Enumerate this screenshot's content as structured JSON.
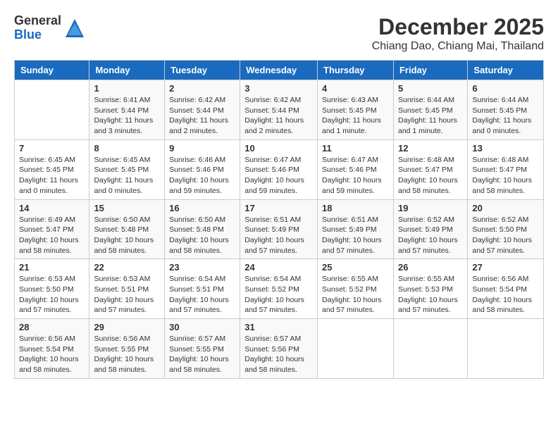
{
  "logo": {
    "general": "General",
    "blue": "Blue"
  },
  "title": "December 2025",
  "location": "Chiang Dao, Chiang Mai, Thailand",
  "days_header": [
    "Sunday",
    "Monday",
    "Tuesday",
    "Wednesday",
    "Thursday",
    "Friday",
    "Saturday"
  ],
  "weeks": [
    [
      {
        "day": "",
        "content": ""
      },
      {
        "day": "1",
        "content": "Sunrise: 6:41 AM\nSunset: 5:44 PM\nDaylight: 11 hours\nand 3 minutes."
      },
      {
        "day": "2",
        "content": "Sunrise: 6:42 AM\nSunset: 5:44 PM\nDaylight: 11 hours\nand 2 minutes."
      },
      {
        "day": "3",
        "content": "Sunrise: 6:42 AM\nSunset: 5:44 PM\nDaylight: 11 hours\nand 2 minutes."
      },
      {
        "day": "4",
        "content": "Sunrise: 6:43 AM\nSunset: 5:45 PM\nDaylight: 11 hours\nand 1 minute."
      },
      {
        "day": "5",
        "content": "Sunrise: 6:44 AM\nSunset: 5:45 PM\nDaylight: 11 hours\nand 1 minute."
      },
      {
        "day": "6",
        "content": "Sunrise: 6:44 AM\nSunset: 5:45 PM\nDaylight: 11 hours\nand 0 minutes."
      }
    ],
    [
      {
        "day": "7",
        "content": "Sunrise: 6:45 AM\nSunset: 5:45 PM\nDaylight: 11 hours\nand 0 minutes."
      },
      {
        "day": "8",
        "content": "Sunrise: 6:45 AM\nSunset: 5:45 PM\nDaylight: 11 hours\nand 0 minutes."
      },
      {
        "day": "9",
        "content": "Sunrise: 6:46 AM\nSunset: 5:46 PM\nDaylight: 10 hours\nand 59 minutes."
      },
      {
        "day": "10",
        "content": "Sunrise: 6:47 AM\nSunset: 5:46 PM\nDaylight: 10 hours\nand 59 minutes."
      },
      {
        "day": "11",
        "content": "Sunrise: 6:47 AM\nSunset: 5:46 PM\nDaylight: 10 hours\nand 59 minutes."
      },
      {
        "day": "12",
        "content": "Sunrise: 6:48 AM\nSunset: 5:47 PM\nDaylight: 10 hours\nand 58 minutes."
      },
      {
        "day": "13",
        "content": "Sunrise: 6:48 AM\nSunset: 5:47 PM\nDaylight: 10 hours\nand 58 minutes."
      }
    ],
    [
      {
        "day": "14",
        "content": "Sunrise: 6:49 AM\nSunset: 5:47 PM\nDaylight: 10 hours\nand 58 minutes."
      },
      {
        "day": "15",
        "content": "Sunrise: 6:50 AM\nSunset: 5:48 PM\nDaylight: 10 hours\nand 58 minutes."
      },
      {
        "day": "16",
        "content": "Sunrise: 6:50 AM\nSunset: 5:48 PM\nDaylight: 10 hours\nand 58 minutes."
      },
      {
        "day": "17",
        "content": "Sunrise: 6:51 AM\nSunset: 5:49 PM\nDaylight: 10 hours\nand 57 minutes."
      },
      {
        "day": "18",
        "content": "Sunrise: 6:51 AM\nSunset: 5:49 PM\nDaylight: 10 hours\nand 57 minutes."
      },
      {
        "day": "19",
        "content": "Sunrise: 6:52 AM\nSunset: 5:49 PM\nDaylight: 10 hours\nand 57 minutes."
      },
      {
        "day": "20",
        "content": "Sunrise: 6:52 AM\nSunset: 5:50 PM\nDaylight: 10 hours\nand 57 minutes."
      }
    ],
    [
      {
        "day": "21",
        "content": "Sunrise: 6:53 AM\nSunset: 5:50 PM\nDaylight: 10 hours\nand 57 minutes."
      },
      {
        "day": "22",
        "content": "Sunrise: 6:53 AM\nSunset: 5:51 PM\nDaylight: 10 hours\nand 57 minutes."
      },
      {
        "day": "23",
        "content": "Sunrise: 6:54 AM\nSunset: 5:51 PM\nDaylight: 10 hours\nand 57 minutes."
      },
      {
        "day": "24",
        "content": "Sunrise: 6:54 AM\nSunset: 5:52 PM\nDaylight: 10 hours\nand 57 minutes."
      },
      {
        "day": "25",
        "content": "Sunrise: 6:55 AM\nSunset: 5:52 PM\nDaylight: 10 hours\nand 57 minutes."
      },
      {
        "day": "26",
        "content": "Sunrise: 6:55 AM\nSunset: 5:53 PM\nDaylight: 10 hours\nand 57 minutes."
      },
      {
        "day": "27",
        "content": "Sunrise: 6:56 AM\nSunset: 5:54 PM\nDaylight: 10 hours\nand 58 minutes."
      }
    ],
    [
      {
        "day": "28",
        "content": "Sunrise: 6:56 AM\nSunset: 5:54 PM\nDaylight: 10 hours\nand 58 minutes."
      },
      {
        "day": "29",
        "content": "Sunrise: 6:56 AM\nSunset: 5:55 PM\nDaylight: 10 hours\nand 58 minutes."
      },
      {
        "day": "30",
        "content": "Sunrise: 6:57 AM\nSunset: 5:55 PM\nDaylight: 10 hours\nand 58 minutes."
      },
      {
        "day": "31",
        "content": "Sunrise: 6:57 AM\nSunset: 5:56 PM\nDaylight: 10 hours\nand 58 minutes."
      },
      {
        "day": "",
        "content": ""
      },
      {
        "day": "",
        "content": ""
      },
      {
        "day": "",
        "content": ""
      }
    ]
  ]
}
